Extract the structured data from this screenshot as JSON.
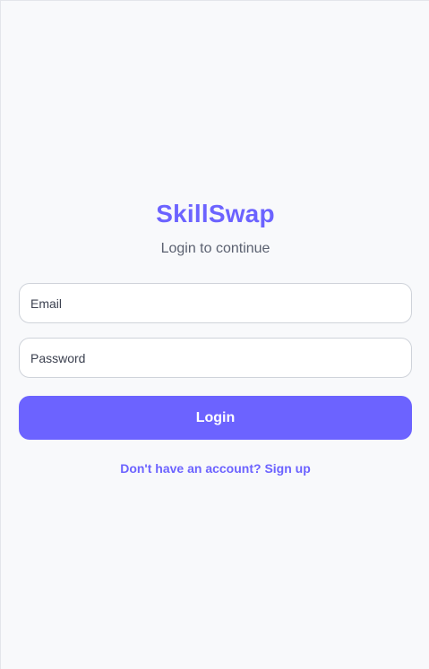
{
  "app": {
    "brand": "SkillSwap",
    "subtitle": "Login to continue"
  },
  "form": {
    "email_placeholder": "Email",
    "email_value": "",
    "password_placeholder": "Password",
    "password_value": "",
    "login_label": "Login"
  },
  "footer": {
    "signup_text": "Don't have an account? Sign up"
  },
  "colors": {
    "accent": "#6c63ff",
    "background": "#f8f9fb",
    "subtitle": "#5b6170"
  }
}
